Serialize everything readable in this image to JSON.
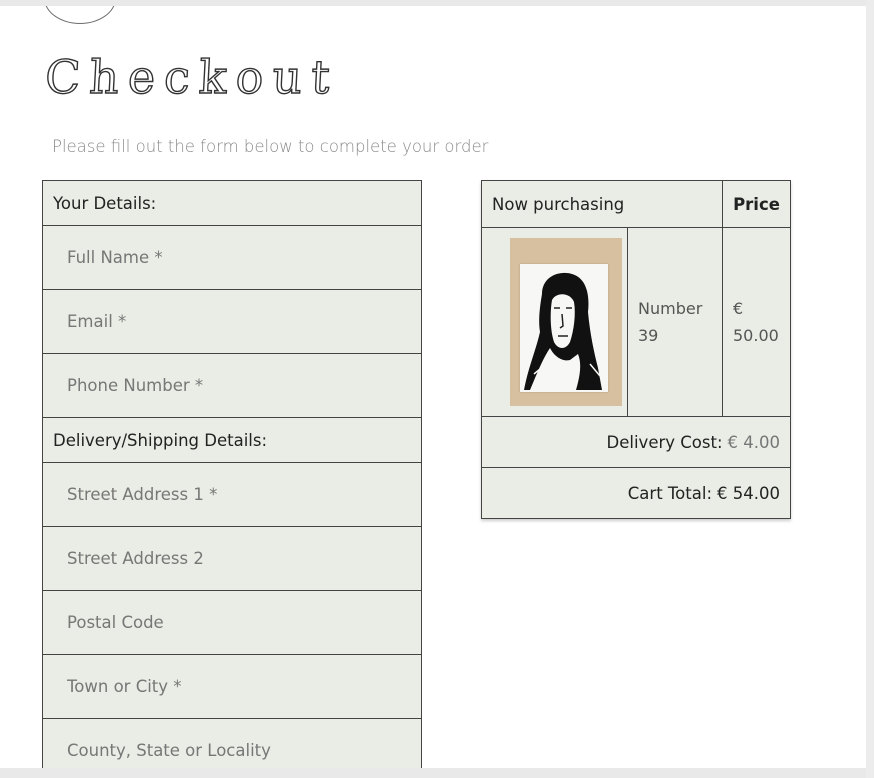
{
  "page": {
    "heading": "Checkout",
    "subtitle": "Please fill out the form below to complete your order"
  },
  "form": {
    "your_details_label": "Your Details:",
    "full_name_placeholder": "Full Name *",
    "email_placeholder": "Email *",
    "phone_placeholder": "Phone Number *",
    "delivery_label": "Delivery/Shipping Details:",
    "street1_placeholder": "Street Address 1 *",
    "street2_placeholder": "Street Address 2",
    "postal_placeholder": "Postal Code",
    "town_placeholder": "Town or City *",
    "county_placeholder": "County, State or Locality"
  },
  "summary": {
    "col_product": "Now purchasing",
    "col_price": "Price",
    "item_name": "Number 39",
    "item_price": "€ 50.00",
    "delivery_label": "Delivery Cost:",
    "delivery_value": "€ 4.00",
    "total_label": "Cart Total:",
    "total_value": "€ 54.00"
  },
  "colors": {
    "panel_bg": "#e9ede5",
    "border": "#444444"
  }
}
